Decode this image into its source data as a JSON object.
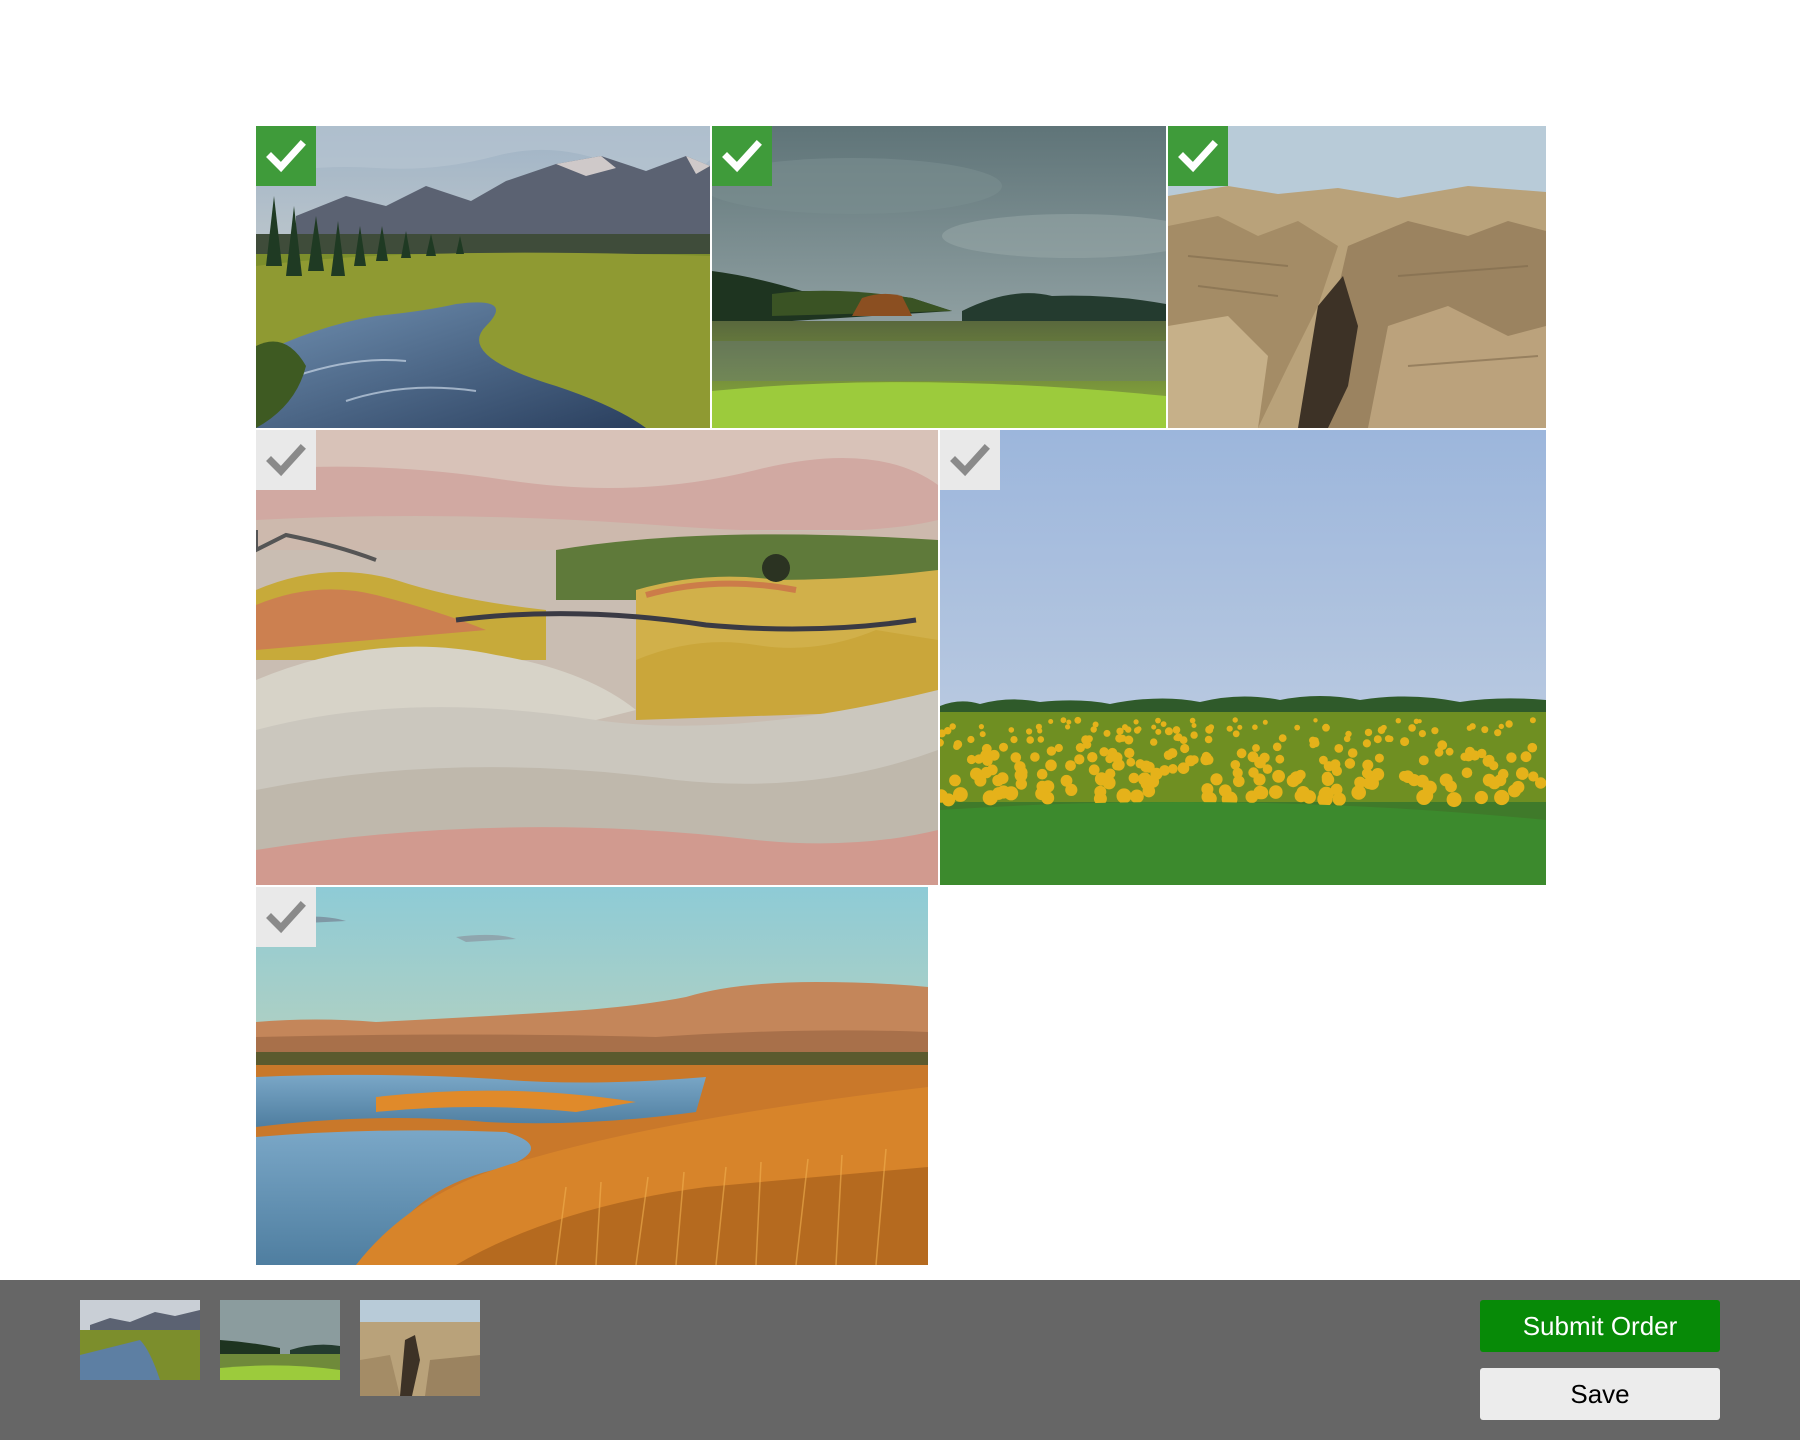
{
  "gallery": {
    "photos": [
      {
        "subject": "mountain stream with forest",
        "selected": true
      },
      {
        "subject": "cloudy lake with green shore",
        "selected": true
      },
      {
        "subject": "rocky canyon badlands",
        "selected": true
      },
      {
        "subject": "painted hills with winding road",
        "selected": false
      },
      {
        "subject": "sunflower field under blue sky",
        "selected": false
      },
      {
        "subject": "golden marsh at sunset",
        "selected": false
      }
    ],
    "check_selected_color": "#3f9b3a",
    "check_unselected_color": "#e9e9e9"
  },
  "tray": {
    "background": "#666666",
    "selected_thumbnails": [
      {
        "subject": "mountain stream with forest"
      },
      {
        "subject": "cloudy lake with green shore"
      },
      {
        "subject": "rocky canyon badlands"
      }
    ],
    "submit_label": "Submit Order",
    "save_label": "Save",
    "submit_color": "#078a07"
  }
}
